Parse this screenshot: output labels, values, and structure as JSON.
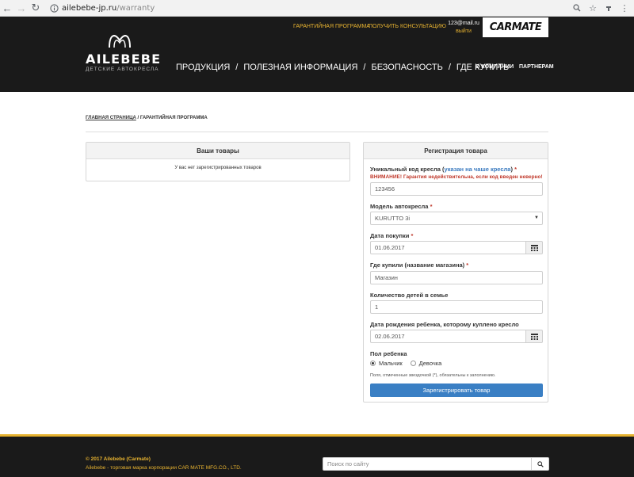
{
  "browser": {
    "back": "←",
    "forward": "→",
    "reload": "↻",
    "url_host": "ailebebe-jp.ru",
    "url_path": "/warranty"
  },
  "header": {
    "logo_text": "AILEBEBE",
    "logo_subtitle": "ДЕТСКИЕ АВТОКРЕСЛА",
    "top_links": [
      "ГАРАНТИЙНАЯ ПРОГРАММА",
      "ПОЛУЧИТЬ КОНСУЛЬТАЦИЮ"
    ],
    "user_email": "123@mail.ru",
    "logout": "выйти",
    "brand": "CARMATE",
    "nav": [
      "ПРОДУКЦИЯ",
      "ПОЛЕЗНАЯ ИНФОРМАЦИЯ",
      "БЕЗОПАСНОСТЬ",
      "ГДЕ КУПИТЬ"
    ],
    "nav_separator": "/",
    "sub_nav": [
      "О КОМПАНИИ",
      "ПАРТНЕРАМ"
    ]
  },
  "breadcrumb": {
    "home": "ГЛАВНАЯ СТРАНИЦА",
    "separator": " / ",
    "current": "ГАРАНТИЙНАЯ ПРОГРАММА"
  },
  "my_products": {
    "title": "Ваши товары",
    "empty": "У вас нет зарегистрированных товаров"
  },
  "registration": {
    "title": "Регистрация товара",
    "code_label": "Уникальный код кресла (",
    "code_hint": "указан на чаше кресла",
    "code_label_end": ")",
    "required_mark": "*",
    "code_warning": "ВНИМАНИЕ! Гарантия недействительна, если код введен неверно!",
    "code_value": "123456",
    "model_label": "Модель автокресла",
    "model_value": "KURUTTO 3i",
    "purchase_date_label": "Дата покупки",
    "purchase_date_value": "01.06.2017",
    "store_label": "Где купили (название магазина)",
    "store_value": "Магазин",
    "children_label": "Количество детей в семье",
    "children_value": "1",
    "birth_date_label": "Дата рождения ребенка, которому куплено кресло",
    "birth_date_value": "02.06.2017",
    "gender_label": "Пол ребенка",
    "gender_options": [
      "Мальчик",
      "Девочка"
    ],
    "gender_selected": "Мальчик",
    "note": "Поля, отмеченные звездочкой (*), обязательны к заполнению.",
    "submit": "Зарегистрировать товар"
  },
  "footer": {
    "copyright": "© 2017 Ailebebe (Carmate)",
    "tagline": "Ailebebe - торговая марка корпорации CAR MATE MFG.CO., LTD.",
    "search_placeholder": "Поиск по сайту"
  },
  "colors": {
    "accent_gold": "#e6b230",
    "header_bg": "#1a1a1a",
    "button_blue": "#3a7fc4",
    "required_red": "#c0392b",
    "hint_blue": "#3a7abf"
  }
}
